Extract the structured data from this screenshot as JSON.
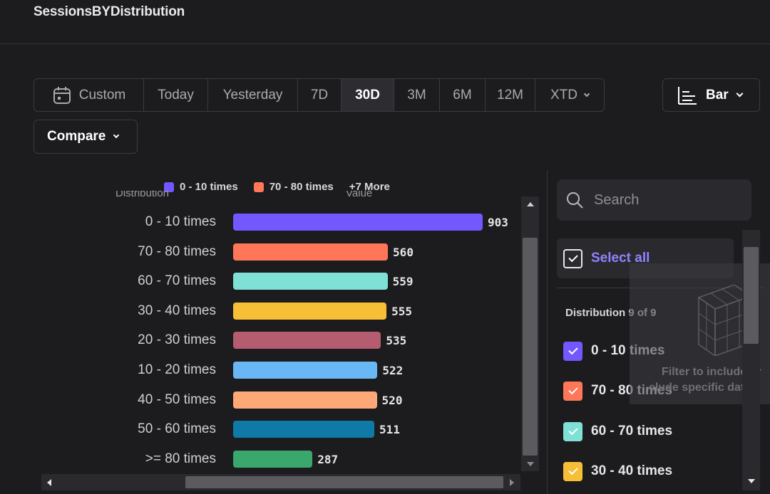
{
  "header": {
    "title": "SessionsBYDistribution"
  },
  "date_range": {
    "options": [
      {
        "label": "Custom",
        "active": false
      },
      {
        "label": "Today",
        "active": false
      },
      {
        "label": "Yesterday",
        "active": false
      },
      {
        "label": "7D",
        "active": false
      },
      {
        "label": "30D",
        "active": true
      },
      {
        "label": "3M",
        "active": false
      },
      {
        "label": "6M",
        "active": false
      },
      {
        "label": "12M",
        "active": false
      },
      {
        "label": "XTD",
        "active": false
      }
    ]
  },
  "toolbar": {
    "chart_type_label": "Bar",
    "compare_label": "Compare"
  },
  "legend": {
    "items": [
      {
        "label": "0 - 10 times",
        "color": "#7357ff"
      },
      {
        "label": "70 - 80 times",
        "color": "#ff7658"
      }
    ],
    "more_label": "+7 More"
  },
  "chart_clipped_labels": {
    "left": "Distribution",
    "right": "Value"
  },
  "chart_data": {
    "type": "bar",
    "orientation": "horizontal",
    "xlabel": "Value",
    "ylabel": "Distribution",
    "categories": [
      "0 - 10 times",
      "70 - 80 times",
      "60 - 70 times",
      "30 - 40 times",
      "20 - 30 times",
      "10 - 20 times",
      "40 - 50 times",
      "50 - 60 times",
      ">= 80 times"
    ],
    "values": [
      903,
      560,
      559,
      555,
      535,
      522,
      520,
      511,
      287
    ],
    "colors": [
      "#7357ff",
      "#ff7658",
      "#7fe0d6",
      "#f7bf35",
      "#b55c70",
      "#6ab7f5",
      "#ffa877",
      "#0f7aa6",
      "#3aa76d"
    ],
    "xlim": [
      0,
      903
    ],
    "grid": false,
    "legend_position": "top"
  },
  "filter_panel": {
    "search_placeholder": "Search",
    "select_all_label": "Select all",
    "group_title": "Distribution 9 of 9",
    "options": [
      {
        "label": "0 - 10 times",
        "color": "#7357ff",
        "checked": true
      },
      {
        "label": "70 - 80 times",
        "color": "#ff7658",
        "checked": true
      },
      {
        "label": "60 - 70 times",
        "color": "#7fe0d6",
        "checked": true
      },
      {
        "label": "30 - 40 times",
        "color": "#f7bf35",
        "checked": true
      }
    ],
    "tooltip_text": [
      "Filter to include or",
      "clude specific data"
    ]
  },
  "icons": {
    "calendar": "calendar-icon",
    "bar_chart": "bar-chart-icon",
    "search": "search-icon",
    "cube": "cube-icon"
  }
}
